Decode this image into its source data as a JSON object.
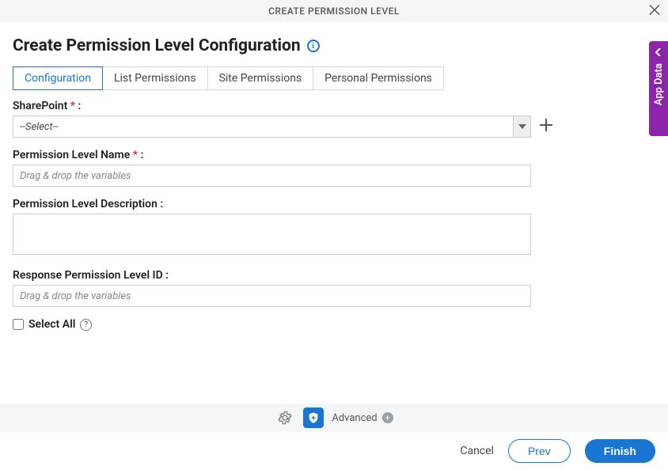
{
  "header": {
    "title": "CREATE PERMISSION LEVEL"
  },
  "page": {
    "title": "Create Permission Level Configuration"
  },
  "tabs": [
    {
      "label": "Configuration",
      "active": true
    },
    {
      "label": "List Permissions",
      "active": false
    },
    {
      "label": "Site Permissions",
      "active": false
    },
    {
      "label": "Personal Permissions",
      "active": false
    }
  ],
  "fields": {
    "sharepoint": {
      "label": "SharePoint",
      "required": true,
      "value": "--Select--"
    },
    "permission_level_name": {
      "label": "Permission Level Name",
      "required": true,
      "placeholder": "Drag & drop the variables",
      "value": ""
    },
    "permission_level_description": {
      "label": "Permission Level Description :",
      "value": ""
    },
    "response_permission_level_id": {
      "label": "Response Permission Level ID :",
      "placeholder": "Drag & drop the variables",
      "value": ""
    },
    "select_all": {
      "label": "Select All",
      "checked": false
    }
  },
  "toolbar": {
    "advanced_label": "Advanced"
  },
  "footer": {
    "cancel": "Cancel",
    "prev": "Prev",
    "finish": "Finish"
  },
  "side_panel": {
    "label": "App Data"
  }
}
